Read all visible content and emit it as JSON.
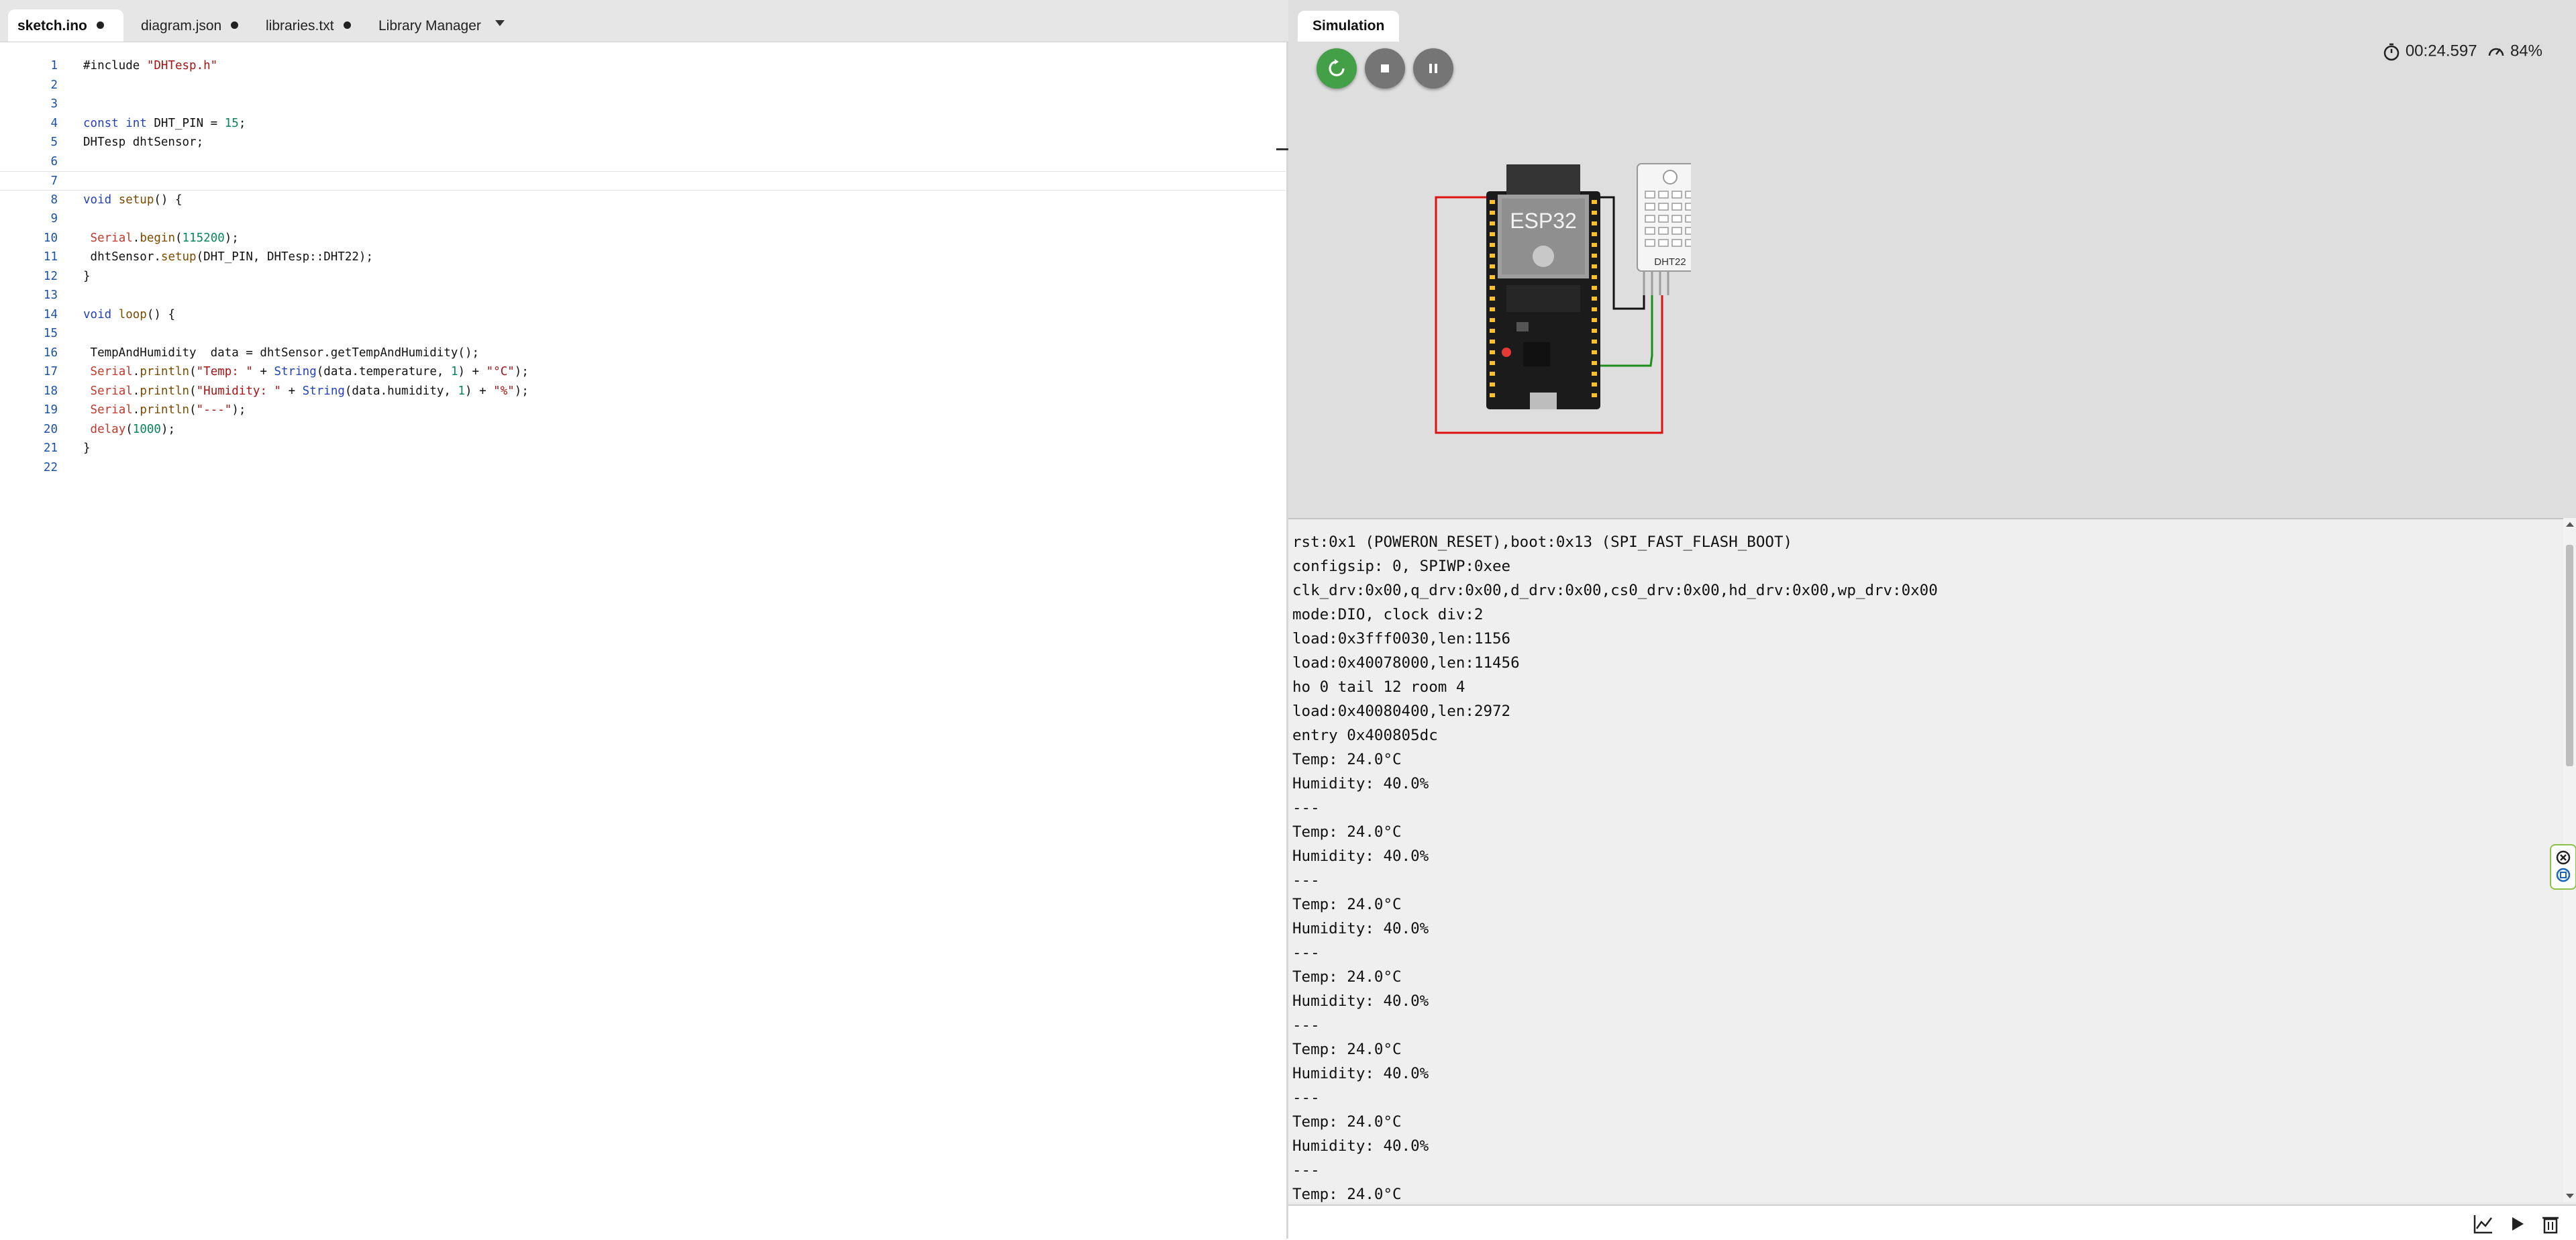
{
  "editor": {
    "tabs": [
      {
        "label": "sketch.ino",
        "modified": true,
        "active": true
      },
      {
        "label": "diagram.json",
        "modified": true,
        "active": false
      },
      {
        "label": "libraries.txt",
        "modified": true,
        "active": false
      },
      {
        "label": "Library Manager",
        "modified": false,
        "active": false
      }
    ],
    "lines": [
      {
        "n": "1",
        "html": "#include <span class=\"str\">\"DHTesp.h\"</span>"
      },
      {
        "n": "2",
        "html": ""
      },
      {
        "n": "3",
        "html": ""
      },
      {
        "n": "4",
        "html": "<span class=\"kw\">const</span> <span class=\"kw\">int</span> DHT_PIN = <span class=\"num\">15</span>;"
      },
      {
        "n": "5",
        "html": "DHTesp dhtSensor;"
      },
      {
        "n": "6",
        "html": ""
      },
      {
        "n": "7",
        "html": ""
      },
      {
        "n": "8",
        "html": "<span class=\"kw\">void</span> <span class=\"fn\">setup</span>() {"
      },
      {
        "n": "9",
        "html": ""
      },
      {
        "n": "10",
        "html": " <span class=\"obj\">Serial</span>.<span class=\"fn\">begin</span>(<span class=\"num\">115200</span>);"
      },
      {
        "n": "11",
        "html": " dhtSensor.<span class=\"fn\">setup</span>(DHT_PIN, DHTesp::DHT22);"
      },
      {
        "n": "12",
        "html": "}"
      },
      {
        "n": "13",
        "html": ""
      },
      {
        "n": "14",
        "html": "<span class=\"kw\">void</span> <span class=\"fn\">loop</span>() {"
      },
      {
        "n": "15",
        "html": ""
      },
      {
        "n": "16",
        "html": " TempAndHumidity  data = dhtSensor.getTempAndHumidity();"
      },
      {
        "n": "17",
        "html": " <span class=\"obj\">Serial</span>.<span class=\"fn\">println</span>(<span class=\"str\">\"Temp: \"</span> + <span class=\"cls\">String</span>(data.temperature, <span class=\"num\">1</span>) + <span class=\"str\">\"°C\"</span>);"
      },
      {
        "n": "18",
        "html": " <span class=\"obj\">Serial</span>.<span class=\"fn\">println</span>(<span class=\"str\">\"Humidity: \"</span> + <span class=\"cls\">String</span>(data.humidity, <span class=\"num\">1</span>) + <span class=\"str\">\"%\"</span>);"
      },
      {
        "n": "19",
        "html": " <span class=\"obj\">Serial</span>.<span class=\"fn\">println</span>(<span class=\"str\">\"---\"</span>);"
      },
      {
        "n": "20",
        "html": " <span class=\"obj\">delay</span>(<span class=\"num\">1000</span>);"
      },
      {
        "n": "21",
        "html": "}"
      },
      {
        "n": "22",
        "html": ""
      }
    ],
    "current_line": "7"
  },
  "simulation": {
    "tab_label": "Simulation",
    "timer": "00:24.597",
    "speed": "84%",
    "buttons": {
      "restart": "restart-icon",
      "stop": "stop-icon",
      "pause": "pause-icon"
    },
    "colors": {
      "restart": "#43a047",
      "control": "#757575"
    },
    "board_label": "ESP32",
    "sensor_label": "DHT22"
  },
  "serial": {
    "lines": [
      "rst:0x1 (POWERON_RESET),boot:0x13 (SPI_FAST_FLASH_BOOT)",
      "configsip: 0, SPIWP:0xee",
      "clk_drv:0x00,q_drv:0x00,d_drv:0x00,cs0_drv:0x00,hd_drv:0x00,wp_drv:0x00",
      "mode:DIO, clock div:2",
      "load:0x3fff0030,len:1156",
      "load:0x40078000,len:11456",
      "ho 0 tail 12 room 4",
      "load:0x40080400,len:2972",
      "entry 0x400805dc",
      "Temp: 24.0°C",
      "Humidity: 40.0%",
      "---",
      "Temp: 24.0°C",
      "Humidity: 40.0%",
      "---",
      "Temp: 24.0°C",
      "Humidity: 40.0%",
      "---",
      "Temp: 24.0°C",
      "Humidity: 40.0%",
      "---",
      "Temp: 24.0°C",
      "Humidity: 40.0%",
      "---",
      "Temp: 24.0°C",
      "Humidity: 40.0%",
      "---",
      "Temp: 24.0°C"
    ]
  }
}
